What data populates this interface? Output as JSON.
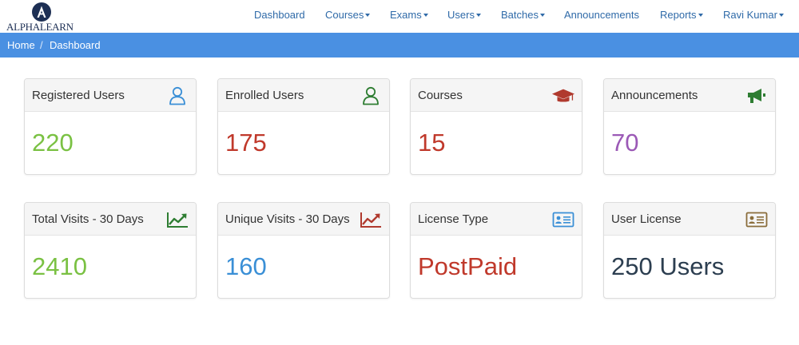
{
  "brand": {
    "name": "ALPHALEARN"
  },
  "nav": {
    "items": [
      {
        "label": "Dashboard",
        "dropdown": false
      },
      {
        "label": "Courses",
        "dropdown": true
      },
      {
        "label": "Exams",
        "dropdown": true
      },
      {
        "label": "Users",
        "dropdown": true
      },
      {
        "label": "Batches",
        "dropdown": true
      },
      {
        "label": "Announcements",
        "dropdown": false
      },
      {
        "label": "Reports",
        "dropdown": true
      },
      {
        "label": "Ravi Kumar",
        "dropdown": true
      }
    ]
  },
  "breadcrumb": {
    "home": "Home",
    "separator": "/",
    "current": "Dashboard"
  },
  "cards": [
    {
      "title": "Registered Users",
      "value": "220",
      "value_color": "#7ac143",
      "icon": "user-outline-icon",
      "icon_color": "#3a8fd6"
    },
    {
      "title": "Enrolled Users",
      "value": "175",
      "value_color": "#c0392b",
      "icon": "user-outline-icon",
      "icon_color": "#2e7d32"
    },
    {
      "title": "Courses",
      "value": "15",
      "value_color": "#c0392b",
      "icon": "graduation-cap-icon",
      "icon_color": "#b03a2e"
    },
    {
      "title": "Announcements",
      "value": "70",
      "value_color": "#9b59b6",
      "icon": "megaphone-icon",
      "icon_color": "#2e7d32"
    },
    {
      "title": "Total Visits - 30 Days",
      "value": "2410",
      "value_color": "#7ac143",
      "icon": "line-chart-icon",
      "icon_color": "#2e7d32"
    },
    {
      "title": "Unique Visits - 30 Days",
      "value": "160",
      "value_color": "#3a8fd6",
      "icon": "line-chart-icon",
      "icon_color": "#b03a2e"
    },
    {
      "title": "License Type",
      "value": "PostPaid",
      "value_color": "#c0392b",
      "icon": "id-card-icon",
      "icon_color": "#3a8fd6"
    },
    {
      "title": "User License",
      "value": "250 Users",
      "value_color": "#2c3e50",
      "icon": "id-card-icon",
      "icon_color": "#8a6d3b"
    }
  ],
  "colors": {
    "breadcrumb_bar": "#4a90e2",
    "nav_link": "#2f6aa8"
  }
}
